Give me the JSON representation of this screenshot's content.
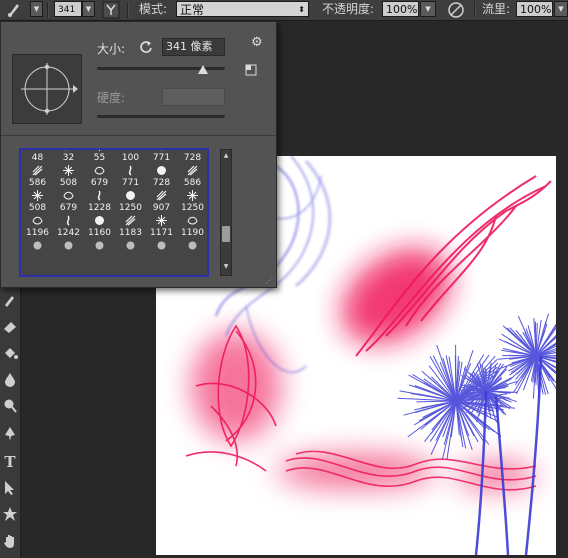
{
  "options_bar": {
    "brush_size": "341",
    "mode_label": "模式:",
    "mode_value": "正常",
    "opacity_label": "不透明度:",
    "opacity_value": "100%",
    "flow_label": "流里:",
    "flow_value": "100%"
  },
  "brush_panel": {
    "size_label": "大小:",
    "size_value": "341 像素",
    "size_slider_fraction": 0.84,
    "hardness_label": "硬度:",
    "presets": [
      [
        "48",
        "32",
        "55",
        "100",
        "771",
        "728"
      ],
      [
        "586",
        "508",
        "679",
        "771",
        "728",
        "586"
      ],
      [
        "508",
        "679",
        "1228",
        "1250",
        "907",
        "1250"
      ],
      [
        "1196",
        "1242",
        "1160",
        "1183",
        "1171",
        "1190"
      ]
    ]
  },
  "toolbar": {
    "tools": [
      "history-brush-icon",
      "eraser-icon",
      "paint-bucket-icon",
      "blur-icon",
      "dodge-icon",
      "pen-icon",
      "type-icon",
      "path-select-icon",
      "shape-icon",
      "hand-icon"
    ]
  },
  "colors": {
    "accent_frame": "#2b30a8",
    "brush_pink": "#f0165a",
    "brush_blue": "#3a3ad6"
  }
}
